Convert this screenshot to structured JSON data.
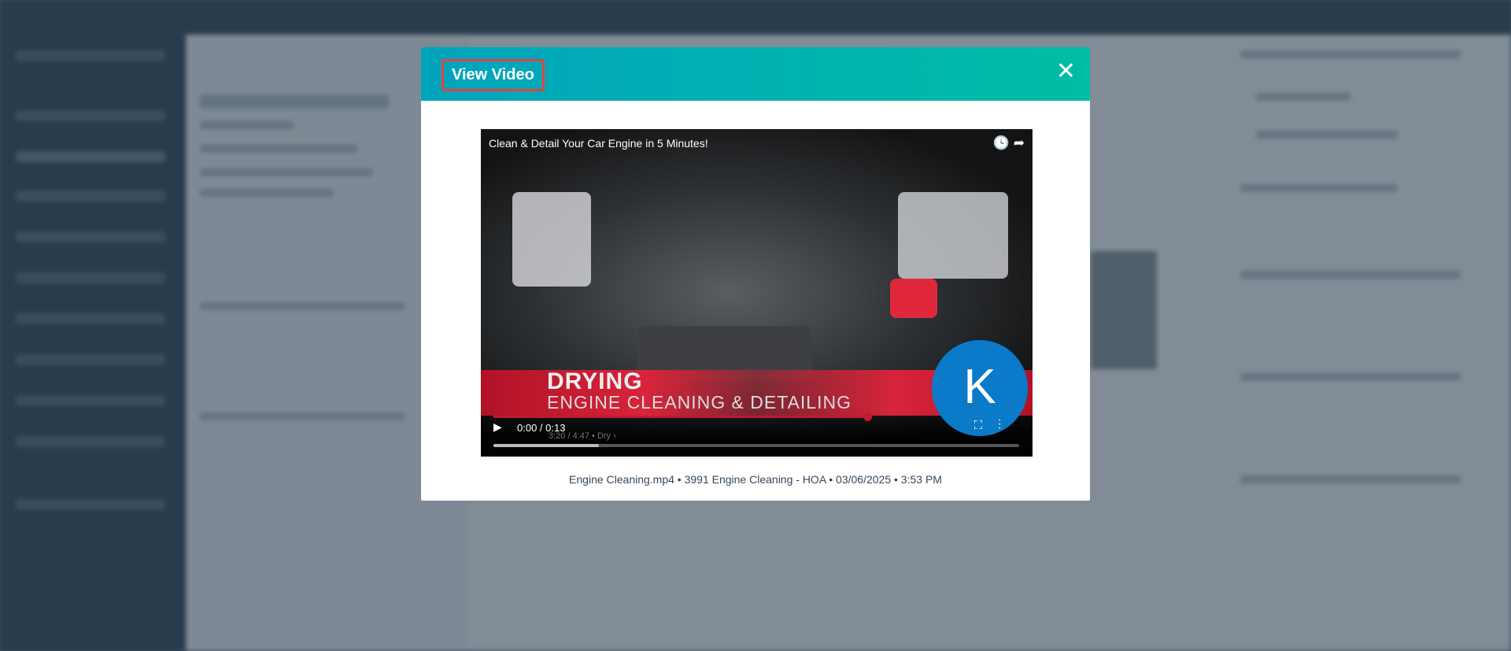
{
  "modal": {
    "title": "View Video",
    "close_icon": "close-icon",
    "video": {
      "title": "Clean & Detail Your Car Engine in 5 Minutes!",
      "banner_heading": "DRYING",
      "banner_subheading": "ENGINE CLEANING & DETAILING",
      "channel_avatar_letter": "K",
      "current_time": "0:00 / 0:13",
      "ghost_chapter": "3:20 / 4:47 • Dry ›",
      "progress_fraction": 0.2
    },
    "caption": "Engine Cleaning.mp4 • 3991 Engine Cleaning - HOA • 03/06/2025 • 3:53 PM"
  },
  "colors": {
    "header_start": "#00a4bd",
    "header_end": "#00bda5",
    "highlight": "#e8403e"
  }
}
